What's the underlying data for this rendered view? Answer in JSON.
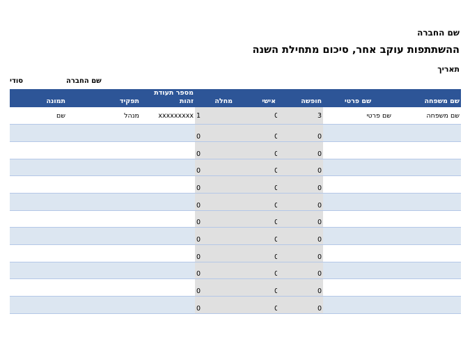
{
  "header": {
    "company": "שם החברה",
    "title": "ההשתתפות עוקב אחר, סיכום מתחילת השנה",
    "date_label": "תאריך"
  },
  "labels": {
    "company": "שם החברה",
    "secret": "סודי"
  },
  "columns": {
    "photo": "תמונה",
    "role": "תפקיד",
    "id_number": "מספר תעודת זהות",
    "illness": "מחלה",
    "personal": "אישי",
    "vacation": "חופשה",
    "first_name": "שם פרטי",
    "last_name": "שם משפחה"
  },
  "rows": [
    {
      "photo": "שם",
      "role": "מנהל",
      "id_number": "xxxxxxxxx",
      "illness": "1",
      "personal": "0",
      "vacation": "3",
      "first_name": "שם פרטי",
      "last_name": "שם משפחה"
    },
    {
      "photo": "",
      "role": "",
      "id_number": "",
      "illness": "0",
      "personal": "0",
      "vacation": "0",
      "first_name": "",
      "last_name": ""
    },
    {
      "photo": "",
      "role": "",
      "id_number": "",
      "illness": "0",
      "personal": "0",
      "vacation": "0",
      "first_name": "",
      "last_name": ""
    },
    {
      "photo": "",
      "role": "",
      "id_number": "",
      "illness": "0",
      "personal": "0",
      "vacation": "0",
      "first_name": "",
      "last_name": ""
    },
    {
      "photo": "",
      "role": "",
      "id_number": "",
      "illness": "0",
      "personal": "0",
      "vacation": "0",
      "first_name": "",
      "last_name": ""
    },
    {
      "photo": "",
      "role": "",
      "id_number": "",
      "illness": "0",
      "personal": "0",
      "vacation": "0",
      "first_name": "",
      "last_name": ""
    },
    {
      "photo": "",
      "role": "",
      "id_number": "",
      "illness": "0",
      "personal": "0",
      "vacation": "0",
      "first_name": "",
      "last_name": ""
    },
    {
      "photo": "",
      "role": "",
      "id_number": "",
      "illness": "0",
      "personal": "0",
      "vacation": "0",
      "first_name": "",
      "last_name": ""
    },
    {
      "photo": "",
      "role": "",
      "id_number": "",
      "illness": "0",
      "personal": "0",
      "vacation": "0",
      "first_name": "",
      "last_name": ""
    },
    {
      "photo": "",
      "role": "",
      "id_number": "",
      "illness": "0",
      "personal": "0",
      "vacation": "0",
      "first_name": "",
      "last_name": ""
    },
    {
      "photo": "",
      "role": "",
      "id_number": "",
      "illness": "0",
      "personal": "0",
      "vacation": "0",
      "first_name": "",
      "last_name": ""
    },
    {
      "photo": "",
      "role": "",
      "id_number": "",
      "illness": "0",
      "personal": "0",
      "vacation": "0",
      "first_name": "",
      "last_name": ""
    }
  ],
  "colors": {
    "header_bg": "#2d5597",
    "band": "#dce6f1",
    "shaded_columns": "#e0e0e0"
  }
}
